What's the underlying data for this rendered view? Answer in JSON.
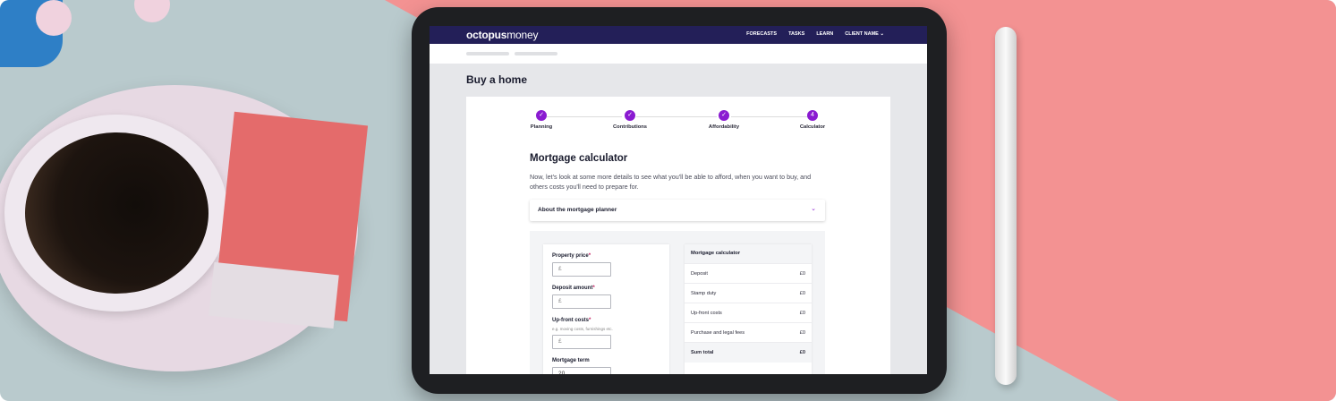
{
  "nav": {
    "logo_bold": "octopus",
    "logo_light": "money",
    "links": [
      "FORECASTS",
      "TASKS",
      "LEARN"
    ],
    "client": "CLIENT NAME",
    "client_chevron": "⌄"
  },
  "page": {
    "title": "Buy a home"
  },
  "steps": [
    {
      "label": "Planning",
      "marker": "✓"
    },
    {
      "label": "Contributions",
      "marker": "✓"
    },
    {
      "label": "Affordability",
      "marker": "✓"
    },
    {
      "label": "Calculator",
      "marker": "4"
    }
  ],
  "calculator": {
    "heading": "Mortgage calculator",
    "intro": "Now, let's look at some more details to see what you'll be able to afford, when you want to buy, and others costs you'll need to prepare for.",
    "accordion_label": "About the mortgage planner",
    "accordion_chevron": "⌄"
  },
  "form": {
    "property_price": {
      "label": "Property price",
      "required": "*",
      "placeholder": "£"
    },
    "deposit_amount": {
      "label": "Deposit amount",
      "required": "*",
      "placeholder": "£"
    },
    "upfront_costs": {
      "label": "Up-front costs",
      "required": "*",
      "hint": "e.g. moving costs, furnishings etc.",
      "placeholder": "£"
    },
    "mortgage_term": {
      "label": "Mortgage term",
      "value": "20"
    }
  },
  "summary": {
    "title": "Mortgage calculator",
    "rows": [
      {
        "label": "Deposit",
        "value": "£0"
      },
      {
        "label": "Stamp duty",
        "value": "£0"
      },
      {
        "label": "Up-front costs",
        "value": "£0"
      },
      {
        "label": "Purchase and legal fees",
        "value": "£0"
      }
    ],
    "total": {
      "label": "Sum total",
      "value": "£0"
    }
  },
  "colors": {
    "nav": "#231f58",
    "accent": "#8a1bd1",
    "required": "#c1185b"
  }
}
